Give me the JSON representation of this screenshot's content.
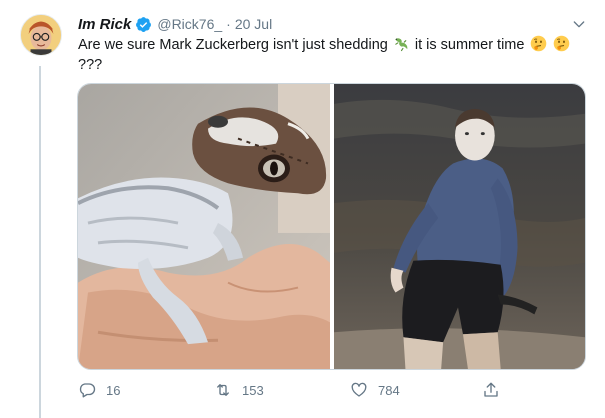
{
  "tweet": {
    "display_name": "Im Rick",
    "handle": "@Rick76_",
    "separator": "·",
    "date": "20 Jul",
    "text_part1": "Are we sure Mark Zuckerberg isn't just shedding",
    "text_part2": "it is summer time",
    "text_line2": "???",
    "emoji_lizard": "lizard-emoji",
    "emoji_thinking": "thinking-face-emoji"
  },
  "actions": {
    "reply_count": "16",
    "retweet_count": "153",
    "like_count": "784"
  },
  "colors": {
    "verified": "#1da1f2",
    "meta_text": "#657786",
    "divider": "#ccd6dd"
  }
}
